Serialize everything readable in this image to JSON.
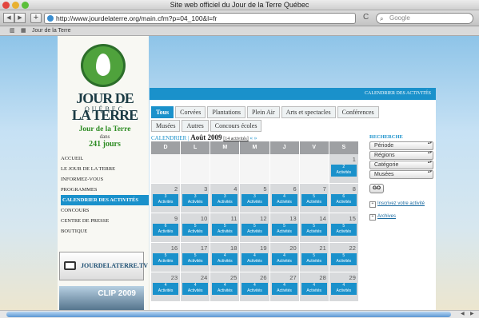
{
  "window": {
    "title": "Site web officiel du Jour de la Terre Québec"
  },
  "toolbar": {
    "url": "http://www.jourdelaterre.org/main.cfm?p=04_100&l=fr",
    "search_placeholder": "Google",
    "back": "◀",
    "forward": "▶",
    "add": "+",
    "reload": "C",
    "search_icon": "search-icon"
  },
  "bookmarks": {
    "items": [
      "Jour de la Terre"
    ],
    "icons": [
      "book-icon",
      "grid-icon"
    ]
  },
  "brand": {
    "logo_text": "JOUR DE LA TERRE",
    "logo_sub": "QUÉBEC",
    "countdown_title": "Jour de la Terre",
    "countdown_dans": "dans",
    "countdown_days": "241 jours"
  },
  "menu": {
    "items": [
      "ACCUEIL",
      "LE JOUR DE LA TERRE",
      "INFORMEZ-VOUS",
      "PROGRAMMES",
      "CALENDRIER DES ACTIVITÉS",
      "CONCOURS",
      "CENTRE DE PRESSE",
      "BOUTIQUE"
    ],
    "active": 4
  },
  "promos": {
    "tv": "JOURDELATERRE.TV",
    "clip": "CLIP 2009"
  },
  "calendar": {
    "banner": "CALENDRIER DES ACTIVITÉS",
    "tabs": [
      "Tous",
      "Corvées",
      "Plantations",
      "Plein Air",
      "Arts et spectacles",
      "Conférences"
    ],
    "tabs2": [
      "Musées",
      "Autres",
      "Concours écoles"
    ],
    "label": "CALENDRIER |",
    "month": "Août 2009",
    "count": "[14 activités]",
    "prev": "«",
    "next": "»",
    "days": [
      "D",
      "L",
      "M",
      "M",
      "J",
      "V",
      "S"
    ],
    "rows": [
      [
        {
          "d": ""
        },
        {
          "d": ""
        },
        {
          "d": ""
        },
        {
          "d": ""
        },
        {
          "d": ""
        },
        {
          "d": ""
        },
        {
          "d": "1",
          "a": "2\nActivités"
        }
      ],
      [
        {
          "d": "2",
          "a": "3\nActivités"
        },
        {
          "d": "3",
          "a": "3\nActivités"
        },
        {
          "d": "4",
          "a": "3\nActivités"
        },
        {
          "d": "5",
          "a": "3\nActivités"
        },
        {
          "d": "6",
          "a": "4\nActivités"
        },
        {
          "d": "7",
          "a": "5\nActivités"
        },
        {
          "d": "8",
          "a": "6\nActivités"
        }
      ],
      [
        {
          "d": "9",
          "a": "6\nActivités"
        },
        {
          "d": "10",
          "a": "5\nActivités"
        },
        {
          "d": "11",
          "a": "5\nActivités"
        },
        {
          "d": "12",
          "a": "5\nActivités"
        },
        {
          "d": "13",
          "a": "5\nActivités"
        },
        {
          "d": "14",
          "a": "5\nActivités"
        },
        {
          "d": "15",
          "a": "5\nActivités"
        }
      ],
      [
        {
          "d": "16",
          "a": "5\nActivités"
        },
        {
          "d": "17",
          "a": "5\nActivités"
        },
        {
          "d": "18",
          "a": "4\nActivités"
        },
        {
          "d": "19",
          "a": "4\nActivités"
        },
        {
          "d": "20",
          "a": "4\nActivités"
        },
        {
          "d": "21",
          "a": "5\nActivités"
        },
        {
          "d": "22",
          "a": "5\nActivités"
        }
      ],
      [
        {
          "d": "23",
          "a": "4\nActivités"
        },
        {
          "d": "24",
          "a": "4\nActivités"
        },
        {
          "d": "25",
          "a": "4\nActivités"
        },
        {
          "d": "26",
          "a": "4\nActivités"
        },
        {
          "d": "27",
          "a": "4\nActivités"
        },
        {
          "d": "28",
          "a": "4\nActivités"
        },
        {
          "d": "29",
          "a": "4\nActivités"
        }
      ]
    ]
  },
  "sidebar": {
    "title": "RECHERCHE",
    "selects": [
      "Période",
      "Régions",
      "Catégorie",
      "Musées"
    ],
    "go": "GO",
    "links": [
      "Inscrivez votre activité",
      "Archives"
    ]
  }
}
